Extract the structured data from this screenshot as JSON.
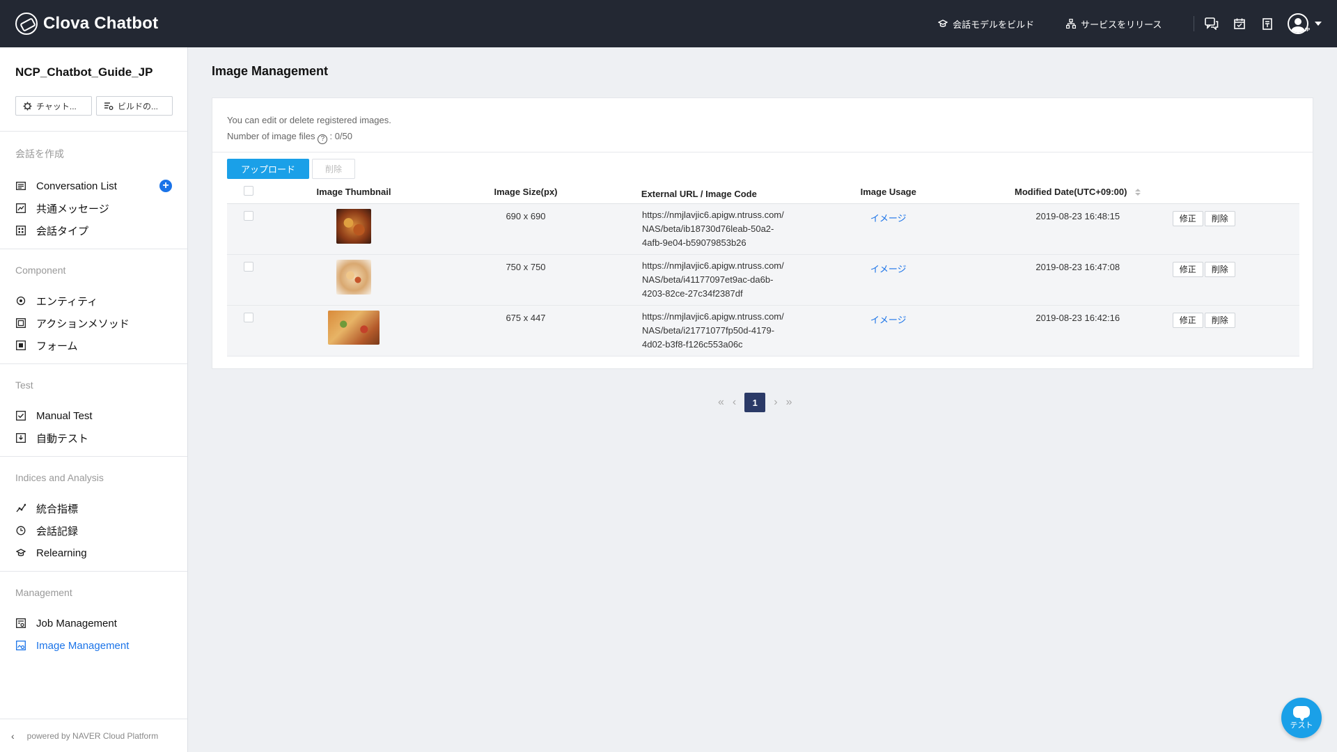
{
  "topbar": {
    "brand": "Clova Chatbot",
    "build_label": "会話モデルをビルド",
    "release_label": "サービスをリリース",
    "avatar_tag": "JP"
  },
  "sidebar": {
    "project_name": "NCP_Chatbot_Guide_JP",
    "chat_button": "チャット...",
    "build_button": "ビルドの...",
    "sections": {
      "create": {
        "title": "会話を作成",
        "items": [
          "Conversation List",
          "共通メッセージ",
          "会話タイプ"
        ]
      },
      "component": {
        "title": "Component",
        "items": [
          "エンティティ",
          "アクションメソッド",
          "フォーム"
        ]
      },
      "test": {
        "title": "Test",
        "items": [
          "Manual Test",
          "自動テスト"
        ]
      },
      "analysis": {
        "title": "Indices and Analysis",
        "items": [
          "統合指標",
          "会話記録",
          "Relearning"
        ]
      },
      "management": {
        "title": "Management",
        "items": [
          "Job Management",
          "Image Management"
        ]
      }
    },
    "footer": "powered by NAVER Cloud Platform"
  },
  "main": {
    "title": "Image Management",
    "info_line1": "You can edit or delete registered images.",
    "info_line2": "Number of image files",
    "info_count": "0/50",
    "upload_button": "アップロード",
    "delete_button": "削除",
    "columns": [
      "Image Thumbnail",
      "Image Size(px)",
      "External URL / Image Code",
      "Image Usage",
      "Modified Date(UTC+09:00)"
    ],
    "rows": [
      {
        "size": "690 x 690",
        "url": [
          "https://nmjlavjic6.apigw.ntruss.com/",
          "NAS/beta/ib18730d76leab-50a2-",
          "4afb-9e04-b59079853b26"
        ],
        "usage": "イメージ",
        "date": "2019-08-23 16:48:15",
        "edit": "修正",
        "delete": "削除"
      },
      {
        "size": "750 x 750",
        "url": [
          "https://nmjlavjic6.apigw.ntruss.com/",
          "NAS/beta/i41177097et9ac-da6b-",
          "4203-82ce-27c34f2387df"
        ],
        "usage": "イメージ",
        "date": "2019-08-23 16:47:08",
        "edit": "修正",
        "delete": "削除"
      },
      {
        "size": "675 x 447",
        "url": [
          "https://nmjlavjic6.apigw.ntruss.com/",
          "NAS/beta/i21771077fp50d-4179-",
          "4d02-b3f8-f126c553a06c"
        ],
        "usage": "イメージ",
        "date": "2019-08-23 16:42:16",
        "edit": "修正",
        "delete": "削除"
      }
    ],
    "pagination": {
      "current": "1"
    }
  },
  "fab": {
    "label": "テスト"
  },
  "colors": {
    "topbar": "#232833",
    "accent": "#1a73e8",
    "upload": "#1aa0e8",
    "pager_active": "#2b3a67"
  }
}
